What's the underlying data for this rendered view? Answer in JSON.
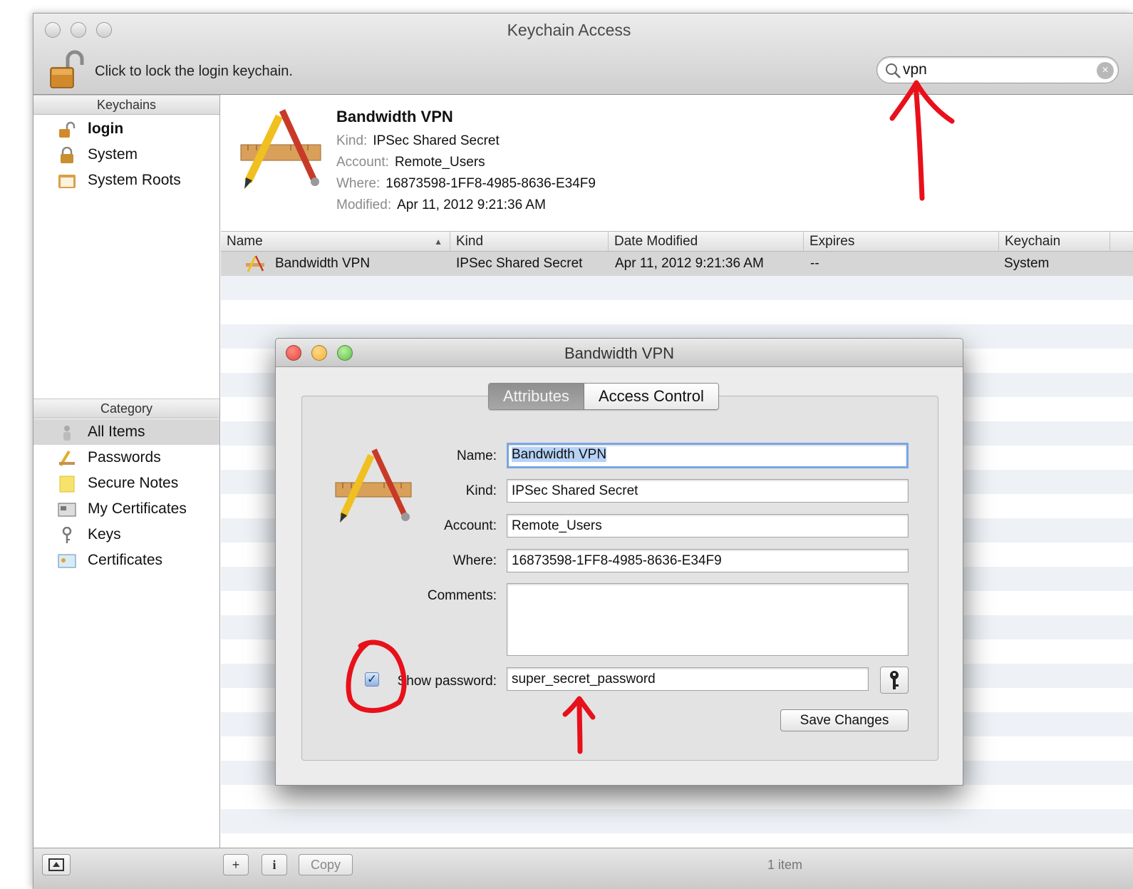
{
  "window": {
    "title": "Keychain Access",
    "lock_text": "Click to lock the login keychain.",
    "search_value": "vpn"
  },
  "sidebar": {
    "keychains_header": "Keychains",
    "keychains": [
      {
        "label": "login",
        "icon": "unlocked-padlock-icon"
      },
      {
        "label": "System",
        "icon": "padlock-icon"
      },
      {
        "label": "System Roots",
        "icon": "certificate-folder-icon"
      }
    ],
    "category_header": "Category",
    "categories": [
      {
        "label": "All Items",
        "icon": "people-icon"
      },
      {
        "label": "Passwords",
        "icon": "pencil-ruler-icon"
      },
      {
        "label": "Secure Notes",
        "icon": "note-icon"
      },
      {
        "label": "My Certificates",
        "icon": "id-card-icon"
      },
      {
        "label": "Keys",
        "icon": "key-icon"
      },
      {
        "label": "Certificates",
        "icon": "certificate-icon"
      }
    ]
  },
  "detail": {
    "title": "Bandwidth VPN",
    "kind_key": "Kind:",
    "kind": "IPSec Shared Secret",
    "account_key": "Account:",
    "account": "Remote_Users",
    "where_key": "Where:",
    "where": "16873598-1FF8-4985-8636-E34F9",
    "modified_key": "Modified:",
    "modified": "Apr 11, 2012 9:21:36 AM"
  },
  "table": {
    "columns": [
      "Name",
      "Kind",
      "Date Modified",
      "Expires",
      "Keychain"
    ],
    "sort_indicator": "▲",
    "rows": [
      {
        "name": "Bandwidth VPN",
        "kind": "IPSec Shared Secret",
        "date": "Apr 11, 2012 9:21:36 AM",
        "expires": "--",
        "keychain": "System"
      }
    ]
  },
  "bottombar": {
    "add_label": "+",
    "info_label": "i",
    "copy_label": "Copy",
    "count": "1 item"
  },
  "dialog": {
    "title": "Bandwidth VPN",
    "tab_attributes": "Attributes",
    "tab_access": "Access Control",
    "name_label": "Name:",
    "name_value": "Bandwidth VPN",
    "kind_label": "Kind:",
    "kind_value": "IPSec Shared Secret",
    "account_label": "Account:",
    "account_value": "Remote_Users",
    "where_label": "Where:",
    "where_value": "16873598-1FF8-4985-8636-E34F9",
    "comments_label": "Comments:",
    "comments_value": "",
    "show_password_label": "Show password:",
    "show_password_checked": true,
    "password_value": "super_secret_password",
    "save_label": "Save Changes"
  },
  "colors": {
    "annotation": "#e8101a",
    "focus_ring": "#7aa7e6",
    "close_dot": "#e2463f",
    "min_dot": "#f2b233",
    "zoom_dot": "#5fbf45"
  }
}
